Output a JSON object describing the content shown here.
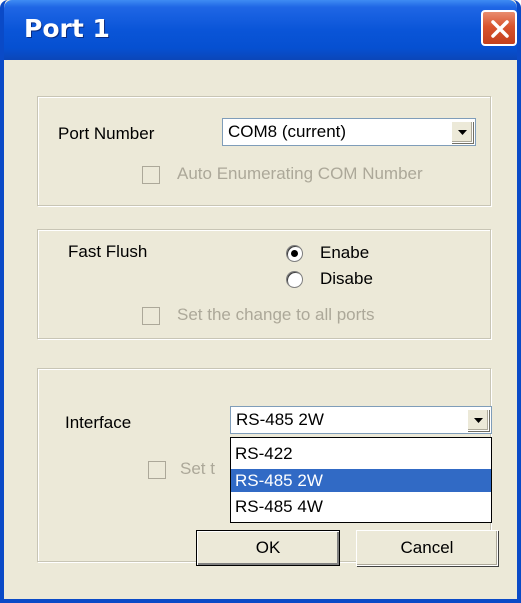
{
  "window": {
    "title": "Port 1",
    "close_icon": "close-icon"
  },
  "port_group": {
    "port_number_label": "Port Number",
    "port_number_value": "COM8 (current)",
    "auto_enum_label": "Auto Enumerating COM Number",
    "auto_enum_checked": false
  },
  "flush_group": {
    "fast_flush_label": "Fast Flush",
    "enable_label": "Enabe",
    "disable_label": "Disabe",
    "selected": "Enabe",
    "set_all_label": "Set the change to all ports"
  },
  "interface_group": {
    "interface_label": "Interface",
    "interface_value": "RS-485 2W",
    "set_partial_label": "Set t",
    "options": [
      "RS-422",
      "RS-485 2W",
      "RS-485 4W"
    ],
    "highlighted_option": "RS-485 2W"
  },
  "buttons": {
    "ok_label": "OK",
    "cancel_label": "Cancel"
  },
  "colors": {
    "title_bar": "#0a55d8",
    "selection": "#316ac5",
    "face": "#ece9d8"
  }
}
